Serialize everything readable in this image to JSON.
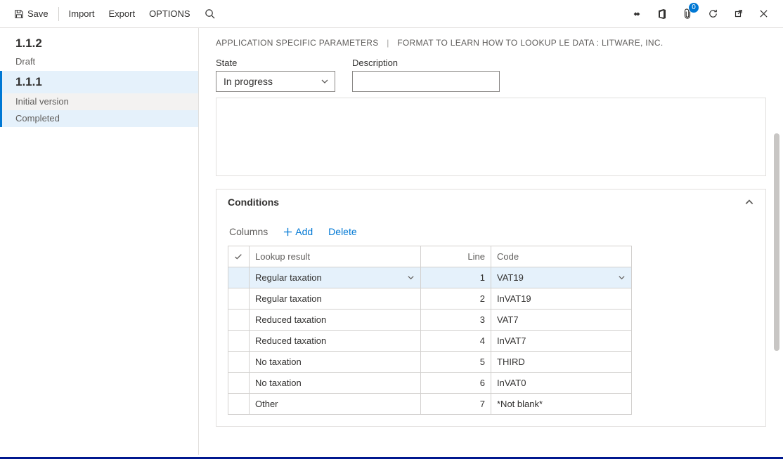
{
  "toolbar": {
    "save": "Save",
    "import": "Import",
    "export": "Export",
    "options": "OPTIONS",
    "badge_count": "0"
  },
  "sidebar": {
    "items": [
      {
        "version": "1.1.2",
        "status": "Draft"
      },
      {
        "version": "1.1.1",
        "lines": [
          "Initial version",
          "Completed"
        ]
      }
    ]
  },
  "breadcrumb": {
    "a": "APPLICATION SPECIFIC PARAMETERS",
    "b": "FORMAT TO LEARN HOW TO LOOKUP LE DATA : LITWARE, INC."
  },
  "fields": {
    "state_label": "State",
    "state_value": "In progress",
    "desc_label": "Description",
    "desc_value": ""
  },
  "conditions": {
    "title": "Conditions",
    "toolbar": {
      "columns": "Columns",
      "add": "Add",
      "delete": "Delete"
    },
    "columns": {
      "lookup": "Lookup result",
      "line": "Line",
      "code": "Code"
    },
    "rows": [
      {
        "lookup": "Regular taxation",
        "line": "1",
        "code": "VAT19",
        "selected": true
      },
      {
        "lookup": "Regular taxation",
        "line": "2",
        "code": "InVAT19"
      },
      {
        "lookup": "Reduced taxation",
        "line": "3",
        "code": "VAT7"
      },
      {
        "lookup": "Reduced taxation",
        "line": "4",
        "code": "InVAT7"
      },
      {
        "lookup": "No taxation",
        "line": "5",
        "code": "THIRD"
      },
      {
        "lookup": "No taxation",
        "line": "6",
        "code": "InVAT0"
      },
      {
        "lookup": "Other",
        "line": "7",
        "code": "*Not blank*"
      }
    ]
  }
}
